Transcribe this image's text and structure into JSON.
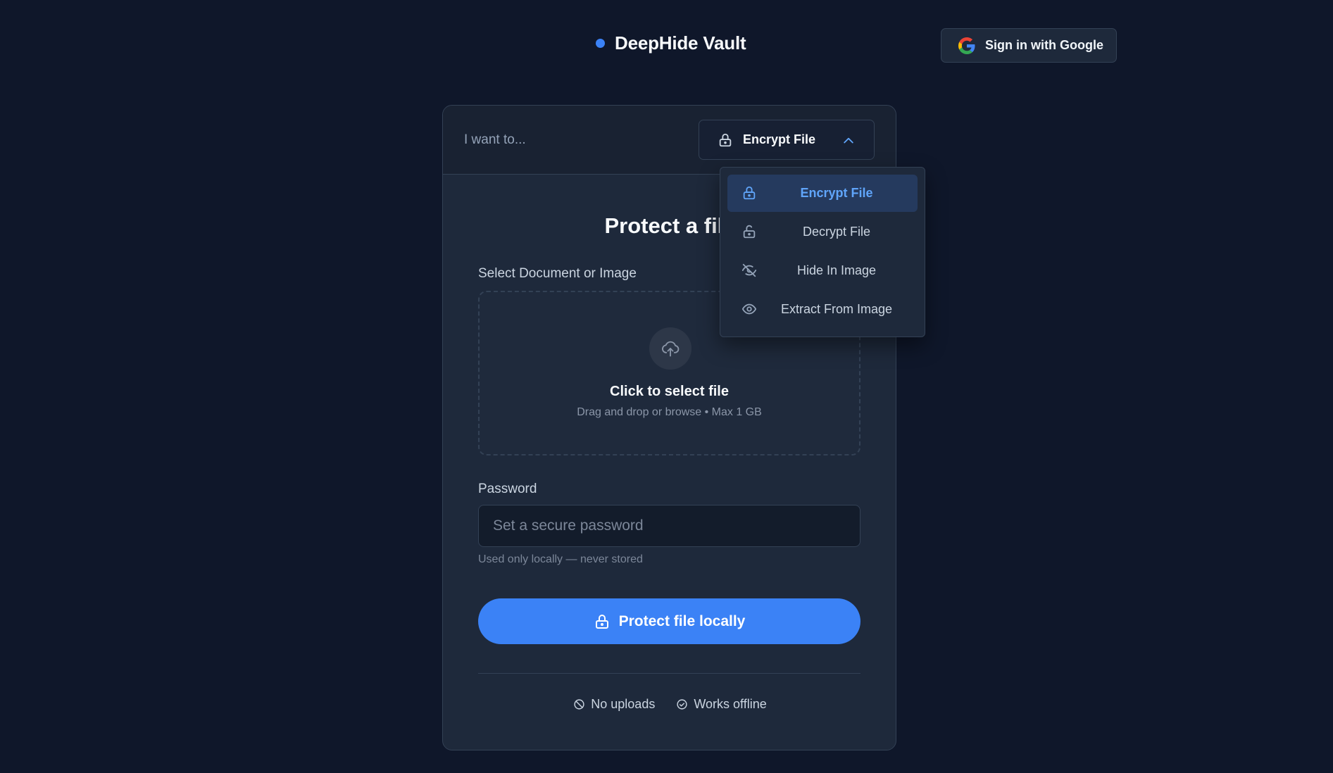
{
  "header": {
    "app_name": "DeepHide Vault",
    "signin_label": "Sign in with Google"
  },
  "card": {
    "prompt": "I want to...",
    "selected_mode": "Encrypt File",
    "title": "Protect a file",
    "file_label": "Select Document or Image",
    "drop_title": "Click to select file",
    "drop_sub": "Drag and drop or browse • Max 1 GB",
    "password_label": "Password",
    "password_placeholder": "Set a secure password",
    "password_value": "",
    "password_hint": "Used only locally — never stored",
    "submit_label": "Protect file locally",
    "badges": [
      {
        "label": "No uploads",
        "icon": "ban-icon"
      },
      {
        "label": "Works offline",
        "icon": "check-circle-icon"
      }
    ]
  },
  "dropdown": {
    "items": [
      {
        "label": "Encrypt File",
        "icon": "lock-icon",
        "active": true
      },
      {
        "label": "Decrypt File",
        "icon": "unlock-icon",
        "active": false
      },
      {
        "label": "Hide In Image",
        "icon": "eye-off-icon",
        "active": false
      },
      {
        "label": "Extract From Image",
        "icon": "eye-icon",
        "active": false
      }
    ]
  },
  "colors": {
    "background": "#0f172a",
    "card": "#1e293b",
    "accent": "#3b82f6",
    "active_item_text": "#60a5fa"
  }
}
